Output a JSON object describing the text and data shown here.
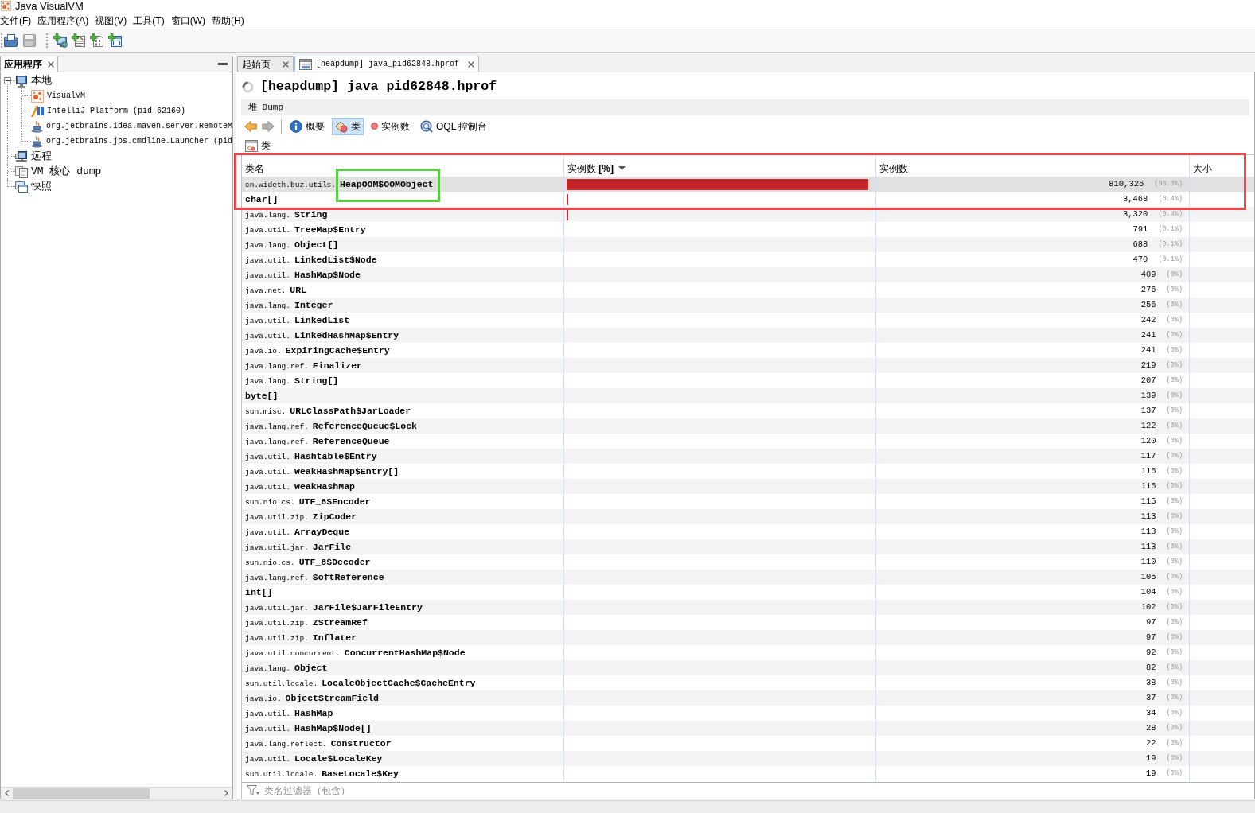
{
  "window": {
    "title": "Java VisualVM"
  },
  "menu": [
    "文件(F)",
    "应用程序(A)",
    "视图(V)",
    "工具(T)",
    "窗口(W)",
    "帮助(H)"
  ],
  "toolbar": [
    {
      "kind": "open",
      "disabled": false
    },
    {
      "kind": "save",
      "disabled": true
    },
    {
      "kind": "add-remote-host",
      "disabled": false
    },
    {
      "kind": "add-jmx",
      "disabled": false
    },
    {
      "kind": "add-core-dump",
      "disabled": false
    },
    {
      "kind": "add-snapshot",
      "disabled": false
    }
  ],
  "side_panel": {
    "tab": "应用程序",
    "tree": [
      {
        "label": "本地",
        "kind": "local",
        "expanded": true,
        "children": [
          {
            "label": "VisualVM",
            "kind": "visualvm"
          },
          {
            "label": "IntelliJ Platform (pid 62160)",
            "kind": "intellij"
          },
          {
            "label": "org.jetbrains.idea.maven.server.RemoteM",
            "kind": "java-app"
          },
          {
            "label": "org.jetbrains.jps.cmdline.Launcher (pid",
            "kind": "java-app"
          }
        ]
      },
      {
        "label": "远程",
        "kind": "remote"
      },
      {
        "label": "VM 核心 dump",
        "kind": "core-dump"
      },
      {
        "label": "快照",
        "kind": "snapshot"
      }
    ]
  },
  "editor_tabs": [
    {
      "label": "起始页",
      "selected": false
    },
    {
      "label": "[heapdump] java_pid62848.hprof",
      "selected": true
    }
  ],
  "heading": "[heapdump] java_pid62848.hprof",
  "subheading": "堆 Dump",
  "view_toolbar": [
    {
      "kind": "back",
      "disabled": false
    },
    {
      "kind": "forward",
      "disabled": true
    },
    {
      "kind": "summary",
      "label": "概要",
      "selected": false
    },
    {
      "kind": "classes",
      "label": "类",
      "selected": true
    },
    {
      "kind": "instances",
      "label": "实例数",
      "selected": false
    },
    {
      "kind": "oql",
      "label": "OQL 控制台",
      "selected": false
    }
  ],
  "section_title": "类",
  "table": {
    "columns": [
      {
        "label": "类名",
        "sorted": false
      },
      {
        "label": "实例数 **[%]**",
        "sorted": true
      },
      {
        "label": "实例数",
        "sorted": false
      },
      {
        "label": "大小",
        "sorted": false
      }
    ],
    "rows": [
      {
        "name": "cn.wideth.buz.utils.**HeapOOM$OOMObject**",
        "kind": "class",
        "selected": true,
        "level": 0.983,
        "count": "810,326",
        "percent": "(98.3%)"
      },
      {
        "name": "char[]",
        "kind": "primitive",
        "selected": false,
        "level": 0.004,
        "count": "3,468",
        "percent": "(0.4%)"
      },
      {
        "name": "java.lang.**String**",
        "kind": "class",
        "selected": false,
        "level": 0.004,
        "count": "3,320",
        "percent": "(0.4%)"
      },
      {
        "name": "java.util.**TreeMap$Entry**",
        "kind": "class",
        "selected": false,
        "count": "791",
        "percent": "(0.1%)"
      },
      {
        "name": "java.lang.**Object[]**",
        "kind": "class",
        "selected": false,
        "count": "688",
        "percent": "(0.1%)"
      },
      {
        "name": "java.util.**LinkedList$Node**",
        "kind": "class",
        "selected": false,
        "count": "470",
        "percent": "(0.1%)"
      },
      {
        "name": "java.util.**HashMap$Node**",
        "kind": "class",
        "selected": false,
        "count": "409",
        "percent": "(0%)"
      },
      {
        "name": "java.net.**URL**",
        "kind": "class",
        "selected": false,
        "count": "276",
        "percent": "(0%)"
      },
      {
        "name": "java.lang.**Integer**",
        "kind": "class",
        "selected": false,
        "count": "256",
        "percent": "(0%)"
      },
      {
        "name": "java.util.**LinkedList**",
        "kind": "class",
        "selected": false,
        "count": "242",
        "percent": "(0%)"
      },
      {
        "name": "java.util.**LinkedHashMap$Entry**",
        "kind": "class",
        "selected": false,
        "count": "241",
        "percent": "(0%)"
      },
      {
        "name": "java.io.**ExpiringCache$Entry**",
        "kind": "class",
        "selected": false,
        "count": "241",
        "percent": "(0%)"
      },
      {
        "name": "java.lang.ref.**Finalizer**",
        "kind": "class",
        "selected": false,
        "count": "219",
        "percent": "(0%)"
      },
      {
        "name": "java.lang.**String[]**",
        "kind": "class",
        "selected": false,
        "count": "207",
        "percent": "(0%)"
      },
      {
        "name": "byte[]",
        "kind": "primitive",
        "selected": false,
        "count": "139",
        "percent": "(0%)"
      },
      {
        "name": "sun.misc.**URLClassPath$JarLoader**",
        "kind": "class",
        "selected": false,
        "count": "137",
        "percent": "(0%)"
      },
      {
        "name": "java.lang.ref.**ReferenceQueue$Lock**",
        "kind": "class",
        "selected": false,
        "count": "122",
        "percent": "(0%)"
      },
      {
        "name": "java.lang.ref.**ReferenceQueue**",
        "kind": "class",
        "selected": false,
        "count": "120",
        "percent": "(0%)"
      },
      {
        "name": "java.util.**Hashtable$Entry**",
        "kind": "class",
        "selected": false,
        "count": "117",
        "percent": "(0%)"
      },
      {
        "name": "java.util.**WeakHashMap$Entry[]**",
        "kind": "class",
        "selected": false,
        "count": "116",
        "percent": "(0%)"
      },
      {
        "name": "java.util.**WeakHashMap**",
        "kind": "class",
        "selected": false,
        "count": "116",
        "percent": "(0%)"
      },
      {
        "name": "sun.nio.cs.**UTF_8$Encoder**",
        "kind": "class",
        "selected": false,
        "count": "115",
        "percent": "(0%)"
      },
      {
        "name": "java.util.zip.**ZipCoder**",
        "kind": "class",
        "selected": false,
        "count": "113",
        "percent": "(0%)"
      },
      {
        "name": "java.util.**ArrayDeque**",
        "kind": "class",
        "selected": false,
        "count": "113",
        "percent": "(0%)"
      },
      {
        "name": "java.util.jar.**JarFile**",
        "kind": "class",
        "selected": false,
        "count": "113",
        "percent": "(0%)"
      },
      {
        "name": "sun.nio.cs.**UTF_8$Decoder**",
        "kind": "class",
        "selected": false,
        "count": "110",
        "percent": "(0%)"
      },
      {
        "name": "java.lang.ref.**SoftReference**",
        "kind": "class",
        "selected": false,
        "count": "105",
        "percent": "(0%)"
      },
      {
        "name": "int[]",
        "kind": "primitive",
        "selected": false,
        "count": "104",
        "percent": "(0%)"
      },
      {
        "name": "java.util.jar.**JarFile$JarFileEntry**",
        "kind": "class",
        "selected": false,
        "count": "102",
        "percent": "(0%)"
      },
      {
        "name": "java.util.zip.**ZStreamRef**",
        "kind": "class",
        "selected": false,
        "count": "97",
        "percent": "(0%)"
      },
      {
        "name": "java.util.zip.**Inflater**",
        "kind": "class",
        "selected": false,
        "count": "97",
        "percent": "(0%)"
      },
      {
        "name": "java.util.concurrent.**ConcurrentHashMap$Node**",
        "kind": "class",
        "selected": false,
        "count": "92",
        "percent": "(0%)"
      },
      {
        "name": "java.lang.**Object**",
        "kind": "class",
        "selected": false,
        "count": "82",
        "percent": "(0%)"
      },
      {
        "name": "sun.util.locale.**LocaleObjectCache$CacheEntry**",
        "kind": "class",
        "selected": false,
        "count": "38",
        "percent": "(0%)"
      },
      {
        "name": "java.io.**ObjectStreamField**",
        "kind": "class",
        "selected": false,
        "count": "37",
        "percent": "(0%)"
      },
      {
        "name": "java.util.**HashMap**",
        "kind": "class",
        "selected": false,
        "count": "34",
        "percent": "(0%)"
      },
      {
        "name": "java.util.**HashMap$Node[]**",
        "kind": "class",
        "selected": false,
        "count": "28",
        "percent": "(0%)"
      },
      {
        "name": "java.lang.reflect.**Constructor**",
        "kind": "class",
        "selected": false,
        "count": "22",
        "percent": "(0%)"
      },
      {
        "name": "java.util.**Locale$LocaleKey**",
        "kind": "class",
        "selected": false,
        "count": "19",
        "percent": "(0%)"
      },
      {
        "name": "sun.util.locale.**BaseLocale$Key**",
        "kind": "class",
        "selected": false,
        "count": "19",
        "percent": "(0%)"
      }
    ]
  },
  "filter": {
    "placeholder": "类名过滤器（包含）"
  },
  "annotations": [
    {
      "kind": "frame",
      "color": "#e8474c"
    },
    {
      "kind": "frame",
      "color": "#5ccb48"
    }
  ]
}
